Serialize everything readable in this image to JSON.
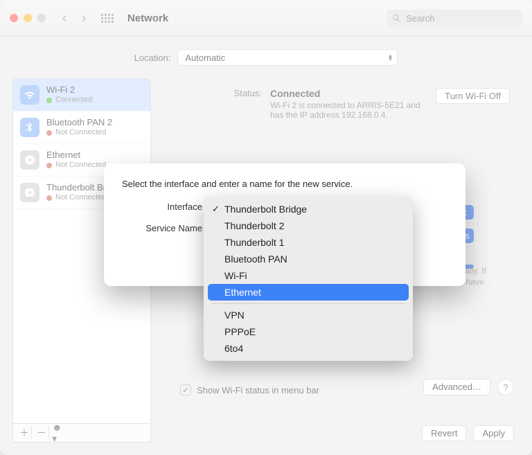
{
  "window": {
    "title": "Network"
  },
  "search": {
    "placeholder": "Search"
  },
  "location": {
    "label": "Location:",
    "value": "Automatic"
  },
  "sidebar": {
    "items": [
      {
        "name": "Wi-Fi 2",
        "status": "Connected",
        "dot": "green",
        "iconStyle": "blue",
        "icon": "wifi",
        "selected": true
      },
      {
        "name": "Bluetooth PAN 2",
        "status": "Not Connected",
        "dot": "red",
        "iconStyle": "blue",
        "icon": "bt",
        "selected": false
      },
      {
        "name": "Ethernet",
        "status": "Not Connected",
        "dot": "red",
        "iconStyle": "gray",
        "icon": "eth",
        "selected": false
      },
      {
        "name": "Thunderbolt Bridge",
        "status": "Not Connected",
        "dot": "red",
        "iconStyle": "gray",
        "icon": "eth",
        "selected": false
      }
    ]
  },
  "detail": {
    "status_label": "Status:",
    "status_value": "Connected",
    "status_sub": "Wi-Fi 2 is connected to ARRIS-5E21 and has the IP address 192.168.0.4.",
    "wifi_off_btn": "Turn Wi-Fi Off",
    "frag_right_1": "ork",
    "frag_right_2": "ts",
    "auto_text_1": "omatically. If",
    "auto_text_2": "ou will have",
    "menubar_checkbox_label": "Show Wi-Fi status in menu bar",
    "advanced_btn": "Advanced…",
    "revert_btn": "Revert",
    "apply_btn": "Apply"
  },
  "sheet": {
    "prompt": "Select the interface and enter a name for the new service.",
    "interface_label": "Interface",
    "service_name_label": "Service Name"
  },
  "menu": {
    "checked_index": 0,
    "highlighted_index": 5,
    "group1": [
      "Thunderbolt Bridge",
      "Thunderbolt 2",
      "Thunderbolt 1",
      "Bluetooth PAN",
      "Wi-Fi",
      "Ethernet"
    ],
    "group2": [
      "VPN",
      "PPPoE",
      "6to4"
    ]
  }
}
